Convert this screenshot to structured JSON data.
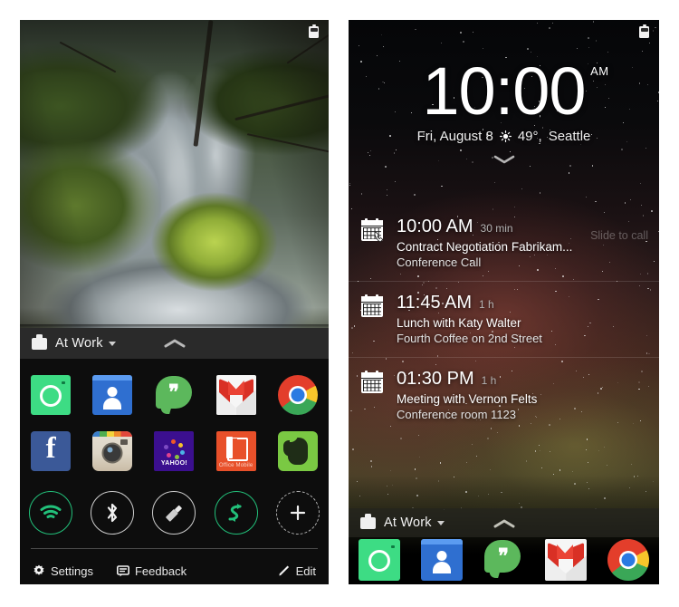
{
  "left_phone": {
    "status_bar": {
      "battery_icon": "battery-icon"
    },
    "wallpaper": {
      "description": "waterfall-moss-wallpaper"
    },
    "shade": {
      "profile_label": "At Work",
      "profile_icon": "briefcase-icon",
      "caret_icon": "caret-down-icon",
      "collapse_icon": "chevron-up-icon",
      "apps": [
        {
          "name": "Camera",
          "icon": "camera-icon"
        },
        {
          "name": "People",
          "icon": "people-icon"
        },
        {
          "name": "Hangouts",
          "icon": "hangouts-icon"
        },
        {
          "name": "Gmail",
          "icon": "gmail-icon"
        },
        {
          "name": "Chrome",
          "icon": "chrome-icon"
        },
        {
          "name": "Facebook",
          "icon": "facebook-icon"
        },
        {
          "name": "Instagram",
          "icon": "instagram-icon"
        },
        {
          "name": "Yahoo",
          "icon": "yahoo-icon",
          "label": "YAHOO!"
        },
        {
          "name": "Office Mobile",
          "icon": "office-icon",
          "label": "Office Mobile"
        },
        {
          "name": "Evernote",
          "icon": "evernote-icon"
        }
      ],
      "toggles": [
        {
          "name": "Wi-Fi",
          "icon": "wifi-icon",
          "state": "on"
        },
        {
          "name": "Bluetooth",
          "icon": "bluetooth-icon",
          "state": "off"
        },
        {
          "name": "Flashlight",
          "icon": "flashlight-icon",
          "state": "off"
        },
        {
          "name": "Sync",
          "icon": "sync-icon",
          "state": "on"
        },
        {
          "name": "Add",
          "icon": "plus-icon",
          "state": "add"
        }
      ],
      "footer": {
        "settings_label": "Settings",
        "settings_icon": "gear-icon",
        "feedback_label": "Feedback",
        "feedback_icon": "feedback-icon",
        "edit_label": "Edit",
        "edit_icon": "pencil-icon"
      }
    }
  },
  "right_phone": {
    "status_bar": {
      "battery_icon": "battery-icon"
    },
    "wallpaper": {
      "description": "night-sky-aurora-wallpaper"
    },
    "lock_screen": {
      "clock_time": "10:00",
      "clock_meridiem": "AM",
      "date": "Fri, August 8",
      "weather_icon": "sun-icon",
      "temperature": "49°,",
      "location": "Seattle",
      "expand_icon": "chevron-down-icon"
    },
    "agenda": [
      {
        "time": "10:00 AM",
        "duration": "30 min",
        "title": "Contract Negotiation Fabrikam...",
        "subtitle": "Conference Call",
        "icon": "calendar-call-icon",
        "action_hint": "Slide to call"
      },
      {
        "time": "11:45 AM",
        "duration": "1 h",
        "title": "Lunch with Katy Walter",
        "subtitle": "Fourth Coffee on 2nd Street",
        "icon": "calendar-icon",
        "action_hint": ""
      },
      {
        "time": "01:30 PM",
        "duration": "1 h",
        "title": "Meeting with Vernon Felts",
        "subtitle": "Conference room 1123",
        "icon": "calendar-icon",
        "action_hint": ""
      }
    ],
    "dock": {
      "profile_label": "At Work",
      "profile_icon": "briefcase-icon",
      "caret_icon": "caret-down-icon",
      "collapse_icon": "chevron-up-icon",
      "apps": [
        {
          "name": "Camera",
          "icon": "camera-icon"
        },
        {
          "name": "People",
          "icon": "people-icon"
        },
        {
          "name": "Hangouts",
          "icon": "hangouts-icon"
        },
        {
          "name": "Gmail",
          "icon": "gmail-icon"
        },
        {
          "name": "Chrome",
          "icon": "chrome-icon"
        }
      ]
    }
  },
  "colors": {
    "accent_green": "#22c07a",
    "shade_background": "#0d0d0d",
    "bar_background": "#2a2a2a"
  }
}
